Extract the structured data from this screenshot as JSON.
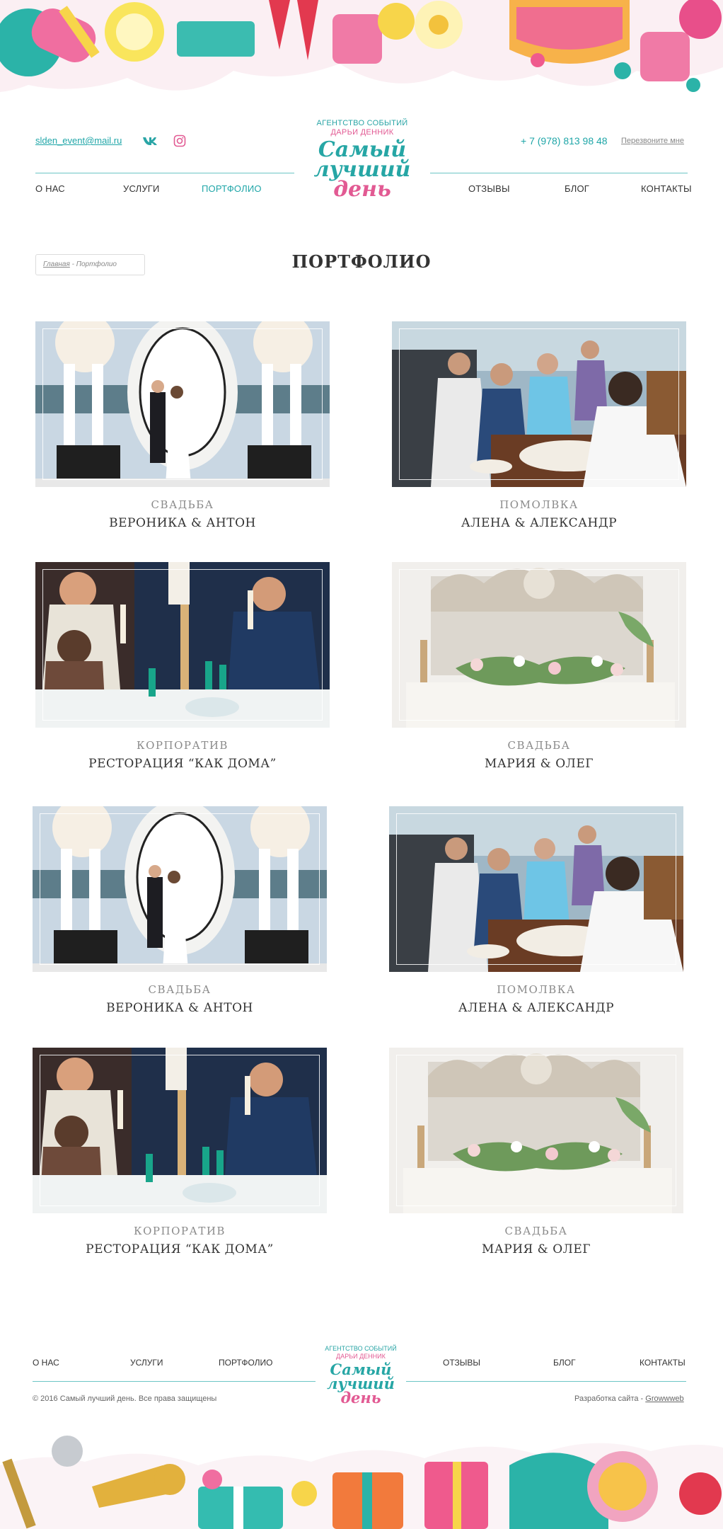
{
  "header": {
    "email": "slden_event@mail.ru",
    "phone": "+ 7 (978) 813 98 48",
    "callback": "Перезвоните мне",
    "logo": {
      "agency": "АГЕНТСТВО СОБЫТИЙ",
      "owner": "ДАРЬИ ДЕННИК",
      "brand_line1": "Самый",
      "brand_line2": "лучший",
      "brand_line3": "день"
    },
    "nav": [
      {
        "label": "О НАС"
      },
      {
        "label": "УСЛУГИ"
      },
      {
        "label": "ПОРТФОЛИО"
      },
      {
        "label": "ОТЗЫВЫ"
      },
      {
        "label": "БЛОГ"
      },
      {
        "label": "КОНТАКТЫ"
      }
    ],
    "active_nav": "ПОРТФОЛИО"
  },
  "breadcrumb": {
    "home": "Главная",
    "separator": " - ",
    "current": "Портфолио"
  },
  "page_title": "ПОРТФОЛИО",
  "portfolio": [
    {
      "category": "СВАДЬБА",
      "name": "ВЕРОНИКА & АНТОН",
      "photo": "wedding-arch"
    },
    {
      "category": "ПОМОЛВКА",
      "name": "АЛЕНА & АЛЕКСАНДР",
      "photo": "engagement-party"
    },
    {
      "category": "КОРПОРАТИВ",
      "name": "РЕСТОРАЦИЯ “КАК ДОМА”",
      "photo": "corporate-toast"
    },
    {
      "category": "СВАДЬБА",
      "name": "МАРИЯ & ОЛЕГ",
      "photo": "wedding-table-decor"
    },
    {
      "category": "СВАДЬБА",
      "name": "ВЕРОНИКА & АНТОН",
      "photo": "wedding-arch"
    },
    {
      "category": "ПОМОЛВКА",
      "name": "АЛЕНА & АЛЕКСАНДР",
      "photo": "engagement-party"
    },
    {
      "category": "КОРПОРАТИВ",
      "name": "РЕСТОРАЦИЯ “КАК ДОМА”",
      "photo": "corporate-toast"
    },
    {
      "category": "СВАДЬБА",
      "name": "МАРИЯ & ОЛЕГ",
      "photo": "wedding-table-decor"
    }
  ],
  "footer": {
    "nav": [
      {
        "label": "О НАС"
      },
      {
        "label": "УСЛУГИ"
      },
      {
        "label": "ПОРТФОЛИО"
      },
      {
        "label": "ОТЗЫВЫ"
      },
      {
        "label": "БЛОГ"
      },
      {
        "label": "КОНТАКТЫ"
      }
    ],
    "copyright": "©  2016  Самый лучший день.  Все права защищены",
    "dev_prefix": "Разработка сайта - ",
    "dev_link": "Growwweb"
  },
  "icons": {
    "vk": "vk-icon",
    "instagram": "instagram-icon"
  },
  "colors": {
    "accent_teal": "#1fa6a8",
    "accent_pink": "#e25a93",
    "text": "#333333"
  }
}
